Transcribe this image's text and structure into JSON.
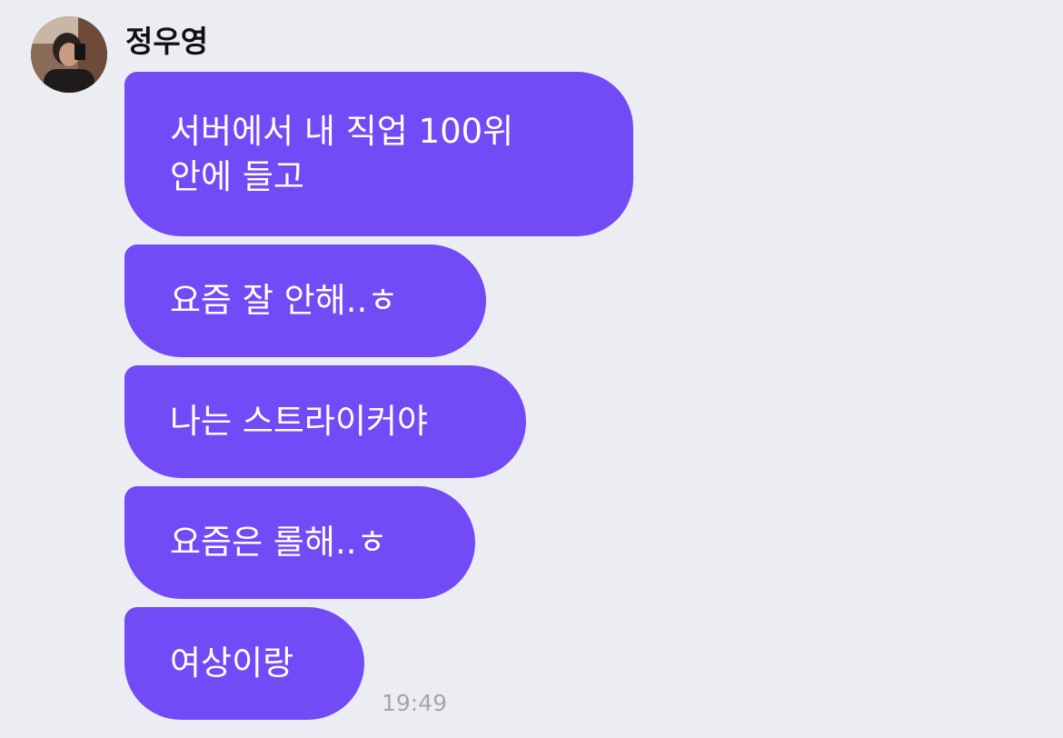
{
  "chat": {
    "sender_name": "정우영",
    "messages": [
      {
        "lines": [
          "서버에서 내 직업 100위",
          "안에 들고"
        ]
      },
      {
        "lines": [
          "요즘 잘 안해..ㅎ"
        ]
      },
      {
        "lines": [
          "나는 스트라이커야"
        ]
      },
      {
        "lines": [
          "요즘은 롤해..ㅎ"
        ]
      },
      {
        "lines": [
          "여상이랑"
        ]
      }
    ],
    "timestamp": "19:49"
  },
  "colors": {
    "background": "#ECEDF2",
    "bubble": "#734BF6",
    "bubble_text": "#FFFFFF",
    "timestamp": "#A4A6AE"
  },
  "icons": {
    "avatar": "profile-photo"
  }
}
